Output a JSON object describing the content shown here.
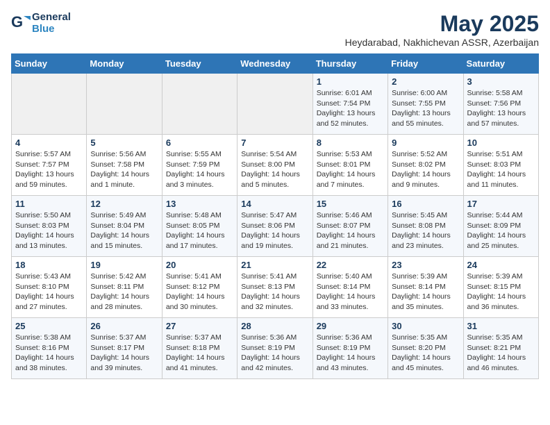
{
  "logo": {
    "line1": "General",
    "line2": "Blue"
  },
  "title": "May 2025",
  "location": "Heydarabad, Nakhichevan ASSR, Azerbaijan",
  "days_of_week": [
    "Sunday",
    "Monday",
    "Tuesday",
    "Wednesday",
    "Thursday",
    "Friday",
    "Saturday"
  ],
  "weeks": [
    [
      {
        "day": "",
        "info": ""
      },
      {
        "day": "",
        "info": ""
      },
      {
        "day": "",
        "info": ""
      },
      {
        "day": "",
        "info": ""
      },
      {
        "day": "1",
        "info": "Sunrise: 6:01 AM\nSunset: 7:54 PM\nDaylight: 13 hours\nand 52 minutes."
      },
      {
        "day": "2",
        "info": "Sunrise: 6:00 AM\nSunset: 7:55 PM\nDaylight: 13 hours\nand 55 minutes."
      },
      {
        "day": "3",
        "info": "Sunrise: 5:58 AM\nSunset: 7:56 PM\nDaylight: 13 hours\nand 57 minutes."
      }
    ],
    [
      {
        "day": "4",
        "info": "Sunrise: 5:57 AM\nSunset: 7:57 PM\nDaylight: 13 hours\nand 59 minutes."
      },
      {
        "day": "5",
        "info": "Sunrise: 5:56 AM\nSunset: 7:58 PM\nDaylight: 14 hours\nand 1 minute."
      },
      {
        "day": "6",
        "info": "Sunrise: 5:55 AM\nSunset: 7:59 PM\nDaylight: 14 hours\nand 3 minutes."
      },
      {
        "day": "7",
        "info": "Sunrise: 5:54 AM\nSunset: 8:00 PM\nDaylight: 14 hours\nand 5 minutes."
      },
      {
        "day": "8",
        "info": "Sunrise: 5:53 AM\nSunset: 8:01 PM\nDaylight: 14 hours\nand 7 minutes."
      },
      {
        "day": "9",
        "info": "Sunrise: 5:52 AM\nSunset: 8:02 PM\nDaylight: 14 hours\nand 9 minutes."
      },
      {
        "day": "10",
        "info": "Sunrise: 5:51 AM\nSunset: 8:03 PM\nDaylight: 14 hours\nand 11 minutes."
      }
    ],
    [
      {
        "day": "11",
        "info": "Sunrise: 5:50 AM\nSunset: 8:03 PM\nDaylight: 14 hours\nand 13 minutes."
      },
      {
        "day": "12",
        "info": "Sunrise: 5:49 AM\nSunset: 8:04 PM\nDaylight: 14 hours\nand 15 minutes."
      },
      {
        "day": "13",
        "info": "Sunrise: 5:48 AM\nSunset: 8:05 PM\nDaylight: 14 hours\nand 17 minutes."
      },
      {
        "day": "14",
        "info": "Sunrise: 5:47 AM\nSunset: 8:06 PM\nDaylight: 14 hours\nand 19 minutes."
      },
      {
        "day": "15",
        "info": "Sunrise: 5:46 AM\nSunset: 8:07 PM\nDaylight: 14 hours\nand 21 minutes."
      },
      {
        "day": "16",
        "info": "Sunrise: 5:45 AM\nSunset: 8:08 PM\nDaylight: 14 hours\nand 23 minutes."
      },
      {
        "day": "17",
        "info": "Sunrise: 5:44 AM\nSunset: 8:09 PM\nDaylight: 14 hours\nand 25 minutes."
      }
    ],
    [
      {
        "day": "18",
        "info": "Sunrise: 5:43 AM\nSunset: 8:10 PM\nDaylight: 14 hours\nand 27 minutes."
      },
      {
        "day": "19",
        "info": "Sunrise: 5:42 AM\nSunset: 8:11 PM\nDaylight: 14 hours\nand 28 minutes."
      },
      {
        "day": "20",
        "info": "Sunrise: 5:41 AM\nSunset: 8:12 PM\nDaylight: 14 hours\nand 30 minutes."
      },
      {
        "day": "21",
        "info": "Sunrise: 5:41 AM\nSunset: 8:13 PM\nDaylight: 14 hours\nand 32 minutes."
      },
      {
        "day": "22",
        "info": "Sunrise: 5:40 AM\nSunset: 8:14 PM\nDaylight: 14 hours\nand 33 minutes."
      },
      {
        "day": "23",
        "info": "Sunrise: 5:39 AM\nSunset: 8:14 PM\nDaylight: 14 hours\nand 35 minutes."
      },
      {
        "day": "24",
        "info": "Sunrise: 5:39 AM\nSunset: 8:15 PM\nDaylight: 14 hours\nand 36 minutes."
      }
    ],
    [
      {
        "day": "25",
        "info": "Sunrise: 5:38 AM\nSunset: 8:16 PM\nDaylight: 14 hours\nand 38 minutes."
      },
      {
        "day": "26",
        "info": "Sunrise: 5:37 AM\nSunset: 8:17 PM\nDaylight: 14 hours\nand 39 minutes."
      },
      {
        "day": "27",
        "info": "Sunrise: 5:37 AM\nSunset: 8:18 PM\nDaylight: 14 hours\nand 41 minutes."
      },
      {
        "day": "28",
        "info": "Sunrise: 5:36 AM\nSunset: 8:19 PM\nDaylight: 14 hours\nand 42 minutes."
      },
      {
        "day": "29",
        "info": "Sunrise: 5:36 AM\nSunset: 8:19 PM\nDaylight: 14 hours\nand 43 minutes."
      },
      {
        "day": "30",
        "info": "Sunrise: 5:35 AM\nSunset: 8:20 PM\nDaylight: 14 hours\nand 45 minutes."
      },
      {
        "day": "31",
        "info": "Sunrise: 5:35 AM\nSunset: 8:21 PM\nDaylight: 14 hours\nand 46 minutes."
      }
    ]
  ]
}
